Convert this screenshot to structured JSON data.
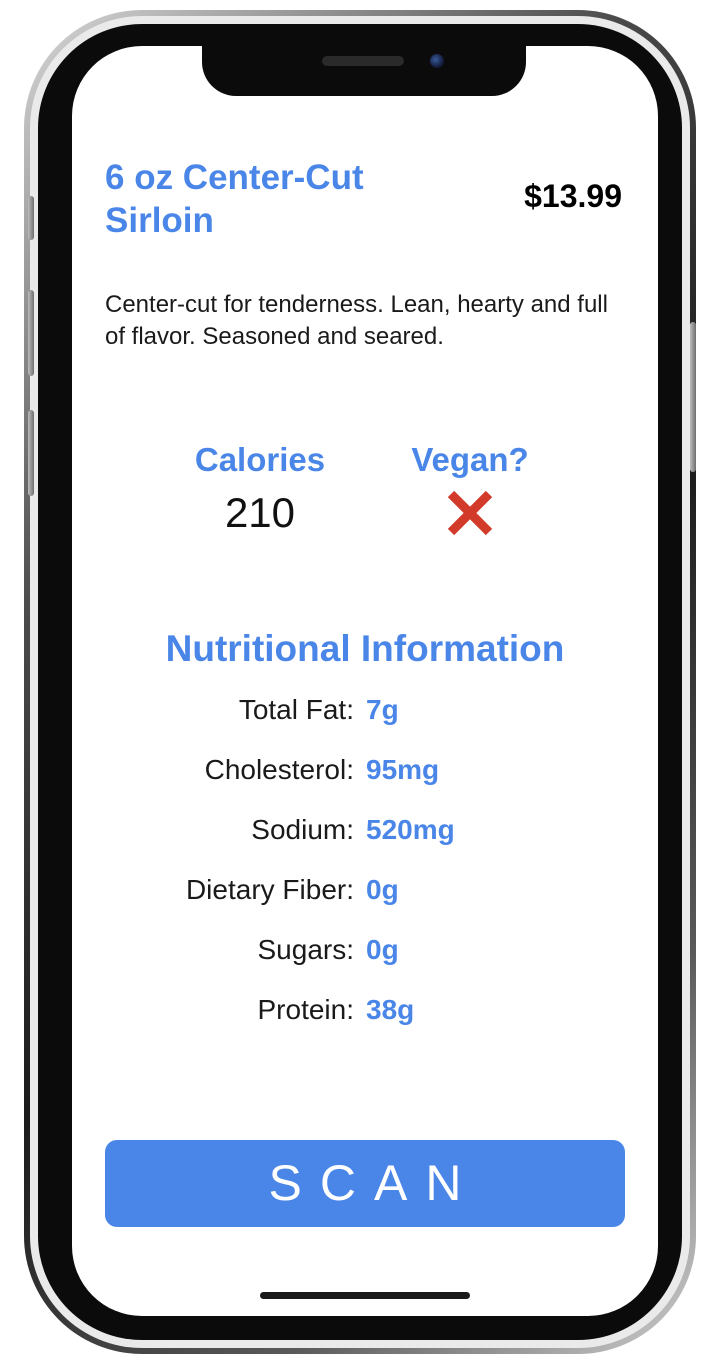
{
  "item": {
    "name": "6 oz Center-Cut Sirloin",
    "price": "$13.99",
    "description": "Center-cut for tenderness. Lean, hearty and full of flavor. Seasoned and seared."
  },
  "stats": {
    "calories_label": "Calories",
    "calories_value": "210",
    "vegan_label": "Vegan?",
    "vegan_icon": "cross-mark-icon",
    "vegan_icon_color": "#d23a2a"
  },
  "nutrition": {
    "title": "Nutritional Information",
    "rows": [
      {
        "label": "Total Fat:",
        "value": "7g"
      },
      {
        "label": "Cholesterol:",
        "value": "95mg"
      },
      {
        "label": "Sodium:",
        "value": "520mg"
      },
      {
        "label": "Dietary Fiber:",
        "value": "0g"
      },
      {
        "label": "Sugars:",
        "value": "0g"
      },
      {
        "label": "Protein:",
        "value": "38g"
      }
    ]
  },
  "actions": {
    "scan_label": "SCAN"
  },
  "colors": {
    "accent": "#4a86e8",
    "text": "#1a1a1a"
  }
}
